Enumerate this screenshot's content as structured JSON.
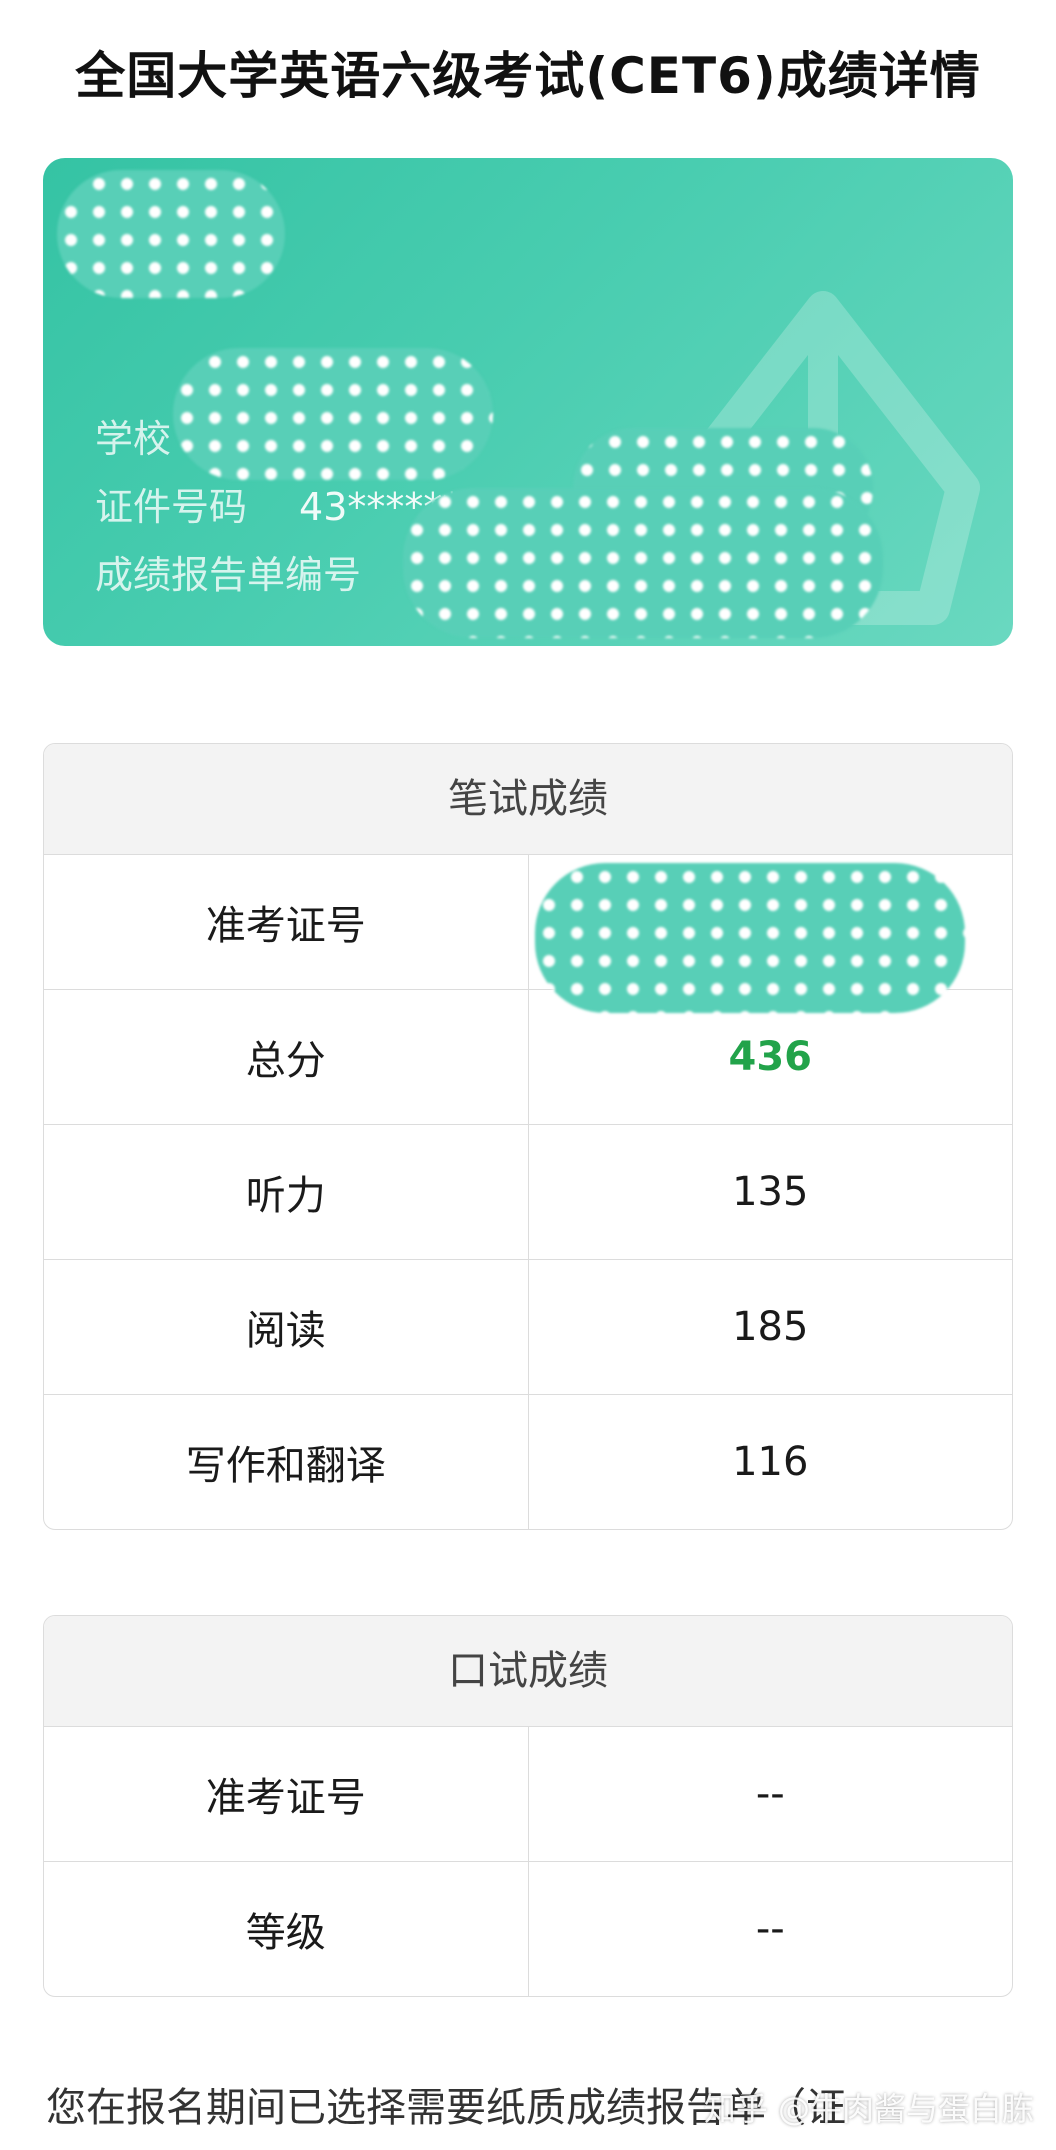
{
  "header": {
    "title": "全国大学英语六级考试(CET6)成绩详情"
  },
  "info_card": {
    "school_label": "学校",
    "id_label": "证件号码",
    "id_value": "43**********",
    "report_no_label": "成绩报告单编号"
  },
  "written": {
    "title": "笔试成绩",
    "rows": [
      {
        "label": "准考证号",
        "value": ""
      },
      {
        "label": "总分",
        "value": "436"
      },
      {
        "label": "听力",
        "value": "135"
      },
      {
        "label": "阅读",
        "value": "185"
      },
      {
        "label": "写作和翻译",
        "value": "116"
      }
    ]
  },
  "oral": {
    "title": "口试成绩",
    "rows": [
      {
        "label": "准考证号",
        "value": "--"
      },
      {
        "label": "等级",
        "value": "--"
      }
    ]
  },
  "footer": {
    "notice": "您在报名期间已选择需要纸质成绩报告单（证",
    "credit": "知乎 @牛肉酱与蛋白胨"
  },
  "colors": {
    "card_accent": "#49cdb0",
    "total_score": "#22a34a"
  }
}
